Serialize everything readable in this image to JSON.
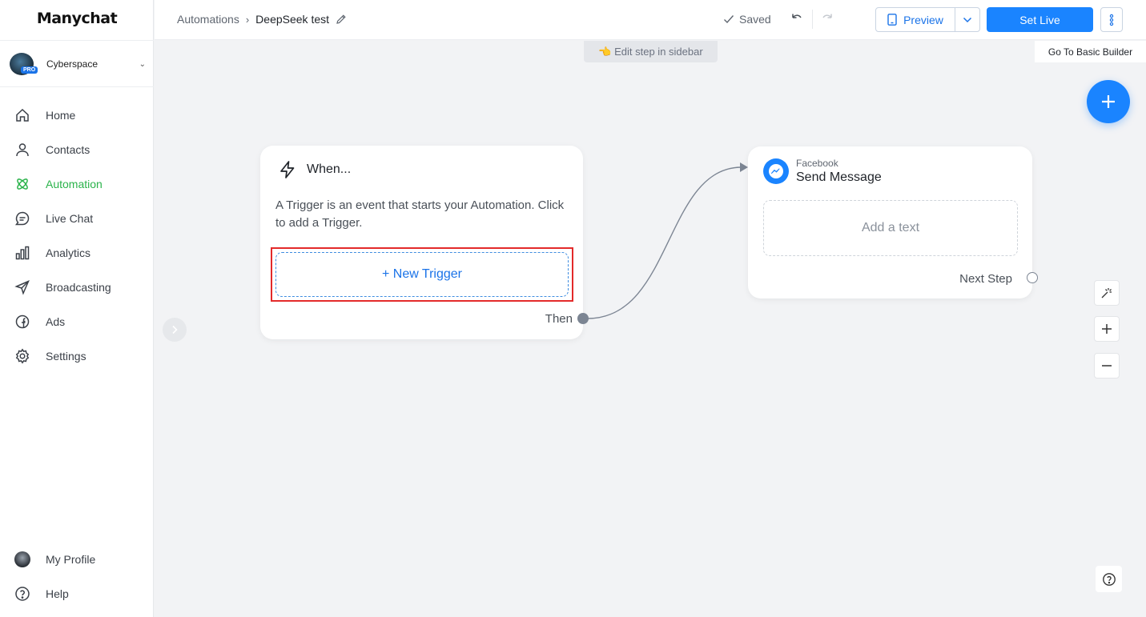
{
  "brand": {
    "logo": "Manychat",
    "accent": "#1a84ff",
    "active_nav": "#2bb34b"
  },
  "account": {
    "name": "Cyberspace",
    "badge": "PRO"
  },
  "nav": {
    "home": "Home",
    "contacts": "Contacts",
    "automation": "Automation",
    "live_chat": "Live Chat",
    "analytics": "Analytics",
    "broadcasting": "Broadcasting",
    "ads": "Ads",
    "settings": "Settings",
    "my_profile": "My Profile",
    "help": "Help"
  },
  "header": {
    "breadcrumb_root": "Automations",
    "breadcrumb_current": "DeepSeek test",
    "saved": "Saved",
    "preview": "Preview",
    "set_live": "Set Live"
  },
  "canvas": {
    "hint": "👈 Edit step in sidebar",
    "basic_builder": "Go To Basic Builder"
  },
  "trigger_card": {
    "title": "When...",
    "description": "A Trigger is an event that starts your Automation. Click to add a Trigger.",
    "new_trigger": "+ New Trigger",
    "then": "Then"
  },
  "message_card": {
    "platform": "Facebook",
    "title": "Send Message",
    "add_text": "Add a text",
    "next_step": "Next Step"
  }
}
